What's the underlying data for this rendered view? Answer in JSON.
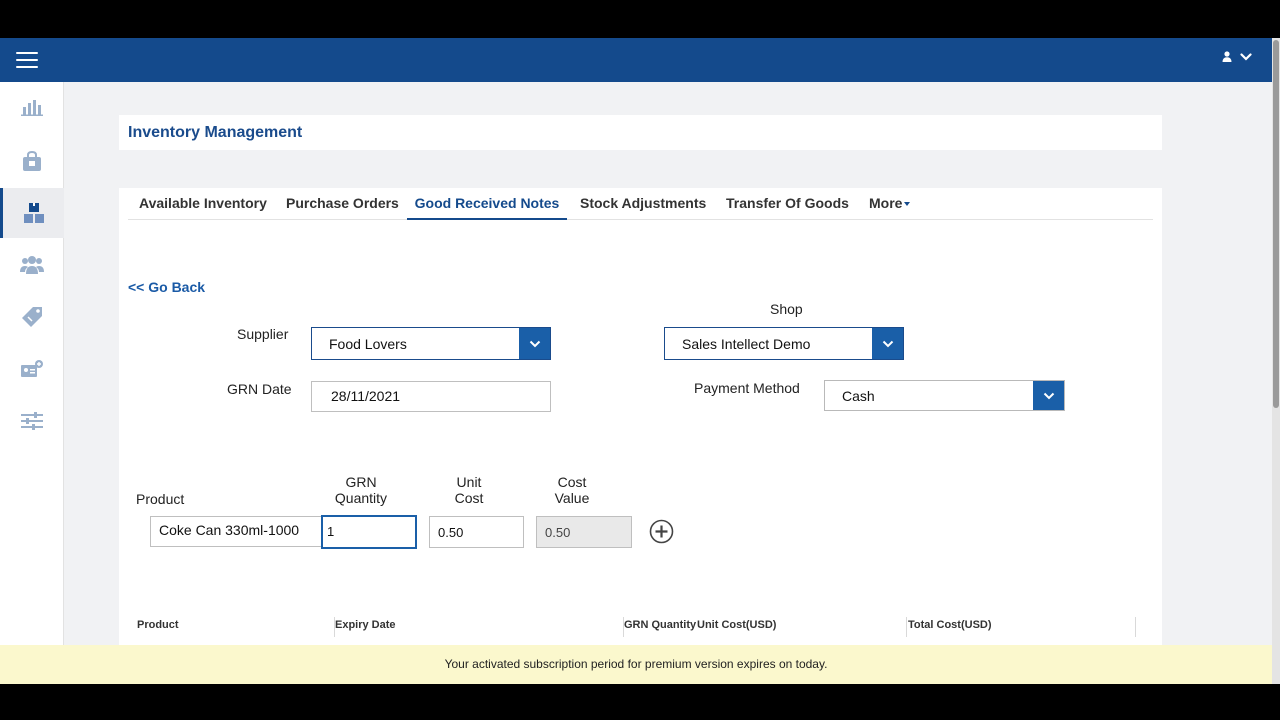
{
  "colors": {
    "navbar": "#144a8c",
    "accent": "#1a5fa8",
    "notice_bg": "#fbf8cd"
  },
  "navbar": {
    "menu_icon": "hamburger-icon",
    "user_icon": "user-icon",
    "user_chevron": "chevron-down-icon"
  },
  "sidebar": {
    "items": [
      {
        "icon": "bar-chart-icon",
        "active": false
      },
      {
        "icon": "shopping-bag-icon",
        "active": false
      },
      {
        "icon": "boxes-icon",
        "active": true
      },
      {
        "icon": "users-icon",
        "active": false
      },
      {
        "icon": "tags-icon",
        "active": false
      },
      {
        "icon": "id-card-icon",
        "active": false
      },
      {
        "icon": "sliders-icon",
        "active": false
      }
    ]
  },
  "page": {
    "title": "Inventory Management"
  },
  "tabs": [
    {
      "label": "Available Inventory",
      "active": false
    },
    {
      "label": "Purchase Orders",
      "active": false
    },
    {
      "label": "Good Received Notes",
      "active": true
    },
    {
      "label": "Stock Adjustments",
      "active": false
    },
    {
      "label": "Transfer Of Goods",
      "active": false
    },
    {
      "label": "More",
      "active": false
    }
  ],
  "form": {
    "go_back": "<< Go Back",
    "supplier_label": "Supplier",
    "supplier_value": "Food Lovers",
    "shop_label": "Shop",
    "shop_value": "Sales Intellect Demo",
    "grn_date_label": "GRN Date",
    "grn_date_value": "28/11/2021",
    "payment_label": "Payment Method",
    "payment_value": "Cash"
  },
  "line_entry": {
    "product_label": "Product",
    "grn_qty_label_1": "GRN",
    "grn_qty_label_2": "Quantity",
    "unit_cost_label_1": "Unit",
    "unit_cost_label_2": "Cost",
    "cost_value_label_1": "Cost",
    "cost_value_label_2": "Value",
    "product_value": "Coke Can 330ml-1000",
    "grn_qty_value": "1",
    "unit_cost_value": "0.50",
    "cost_value_value": "0.50",
    "add_icon": "plus-circle-icon"
  },
  "table": {
    "headers": [
      "Product",
      "Expiry Date",
      "GRN Quantity",
      "Unit Cost(USD)",
      "Total Cost(USD)"
    ]
  },
  "notice": {
    "text": "Your activated subscription period for premium version expires on today."
  }
}
